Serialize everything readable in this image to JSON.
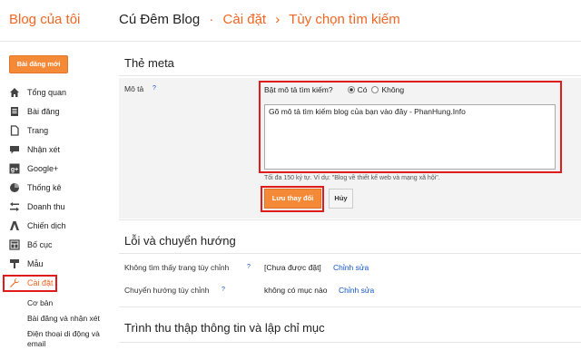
{
  "header": {
    "brand": "Blog của tôi",
    "blog_name": "Cú Đêm Blog",
    "separator": "·",
    "crumb_settings": "Cài đặt",
    "crumb_arrow": "›",
    "crumb_current": "Tùy chọn tìm kiếm"
  },
  "sidebar": {
    "new_post": "Bài đăng mới",
    "items": [
      {
        "label": "Tổng quan",
        "icon": "home-icon"
      },
      {
        "label": "Bài đăng",
        "icon": "posts-icon"
      },
      {
        "label": "Trang",
        "icon": "pages-icon"
      },
      {
        "label": "Nhận xét",
        "icon": "comments-icon"
      },
      {
        "label": "Google+",
        "icon": "google-plus-icon"
      },
      {
        "label": "Thống kê",
        "icon": "stats-icon"
      },
      {
        "label": "Doanh thu",
        "icon": "earnings-icon"
      },
      {
        "label": "Chiến dịch",
        "icon": "campaign-icon"
      },
      {
        "label": "Bố cục",
        "icon": "layout-icon"
      },
      {
        "label": "Mẫu",
        "icon": "template-icon"
      },
      {
        "label": "Cài đặt",
        "icon": "wrench-icon",
        "active": true
      }
    ],
    "sub_items": [
      "Cơ bản",
      "Bài đăng và nhận xét",
      "Điện thoại di động và email"
    ]
  },
  "meta": {
    "title": "Thẻ meta",
    "description_label": "Mô tả",
    "help": "?",
    "enable_question": "Bật mô tả tìm kiếm?",
    "option_yes": "Có",
    "option_no": "Không",
    "selected": "Có",
    "textarea_value": "Gõ mô tả tìm kiếm blog của bạn vào đây - PhanHung.Info",
    "hint": "Tối đa 150 ký tự. Ví dụ: \"Blog về thiết kế web và mạng xã hội\".",
    "save_label": "Lưu thay đổi",
    "cancel_label": "Hủy"
  },
  "errors": {
    "title": "Lỗi và chuyển hướng",
    "rows": [
      {
        "label": "Không tìm thấy trang tùy chỉnh",
        "help": "?",
        "value": "[Chưa được đặt]",
        "link": "Chỉnh sửa"
      },
      {
        "label": "Chuyển hướng tùy chỉnh",
        "help": "?",
        "value": "không có mục nào",
        "link": "Chỉnh sửa"
      }
    ]
  },
  "crawl": {
    "title": "Trình thu thập thông tin và lập chỉ mục"
  },
  "colors": {
    "accent": "#f26522",
    "button": "#f48a38",
    "highlight": "#e01b1b",
    "link": "#1155cc"
  }
}
